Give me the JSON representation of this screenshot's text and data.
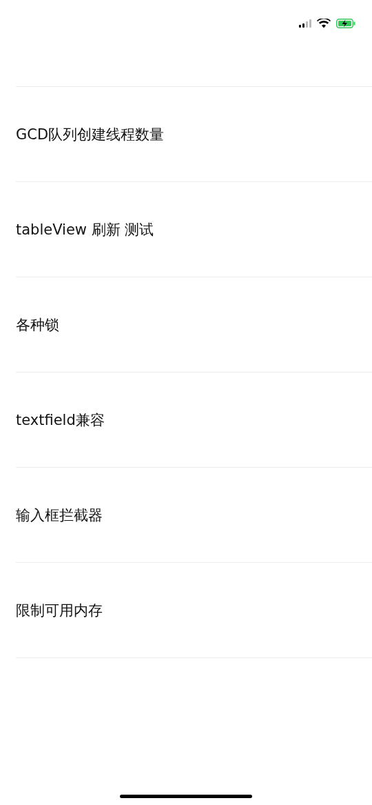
{
  "rows": [
    {
      "title": "GCD队列创建线程数量"
    },
    {
      "title": "tableView 刷新 测试"
    },
    {
      "title": "各种锁"
    },
    {
      "title": "textfield兼容"
    },
    {
      "title": "输入框拦截器"
    },
    {
      "title": "限制可用内存"
    }
  ]
}
